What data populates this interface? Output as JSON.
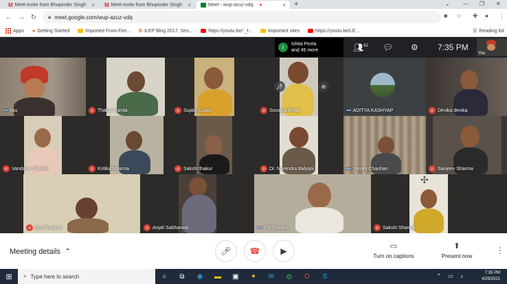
{
  "browser": {
    "tabs": [
      {
        "title": "Meet invite from Bhupinder Singh",
        "icon": "gmail-icon"
      },
      {
        "title": "Meet invite from Bhupinder Singh",
        "icon": "gmail-icon"
      },
      {
        "title": "Meet - wup-azuz-vdq",
        "icon": "meet-icon",
        "active": true
      }
    ],
    "url": "meet.google.com/wup-azuz-vdq",
    "bookmarks": [
      {
        "label": "Apps",
        "icon": "apps-icon"
      },
      {
        "label": "Getting Started",
        "icon": "firefox-icon"
      },
      {
        "label": "Imported From Fire...",
        "icon": "folder-icon"
      },
      {
        "label": "ILEP Blog 2017: Ses...",
        "icon": "blog-icon"
      },
      {
        "label": "https://youtu.be/-_f...",
        "icon": "youtube-icon"
      },
      {
        "label": "Important sites",
        "icon": "folder-icon"
      },
      {
        "label": "https://youtu.be/LE...",
        "icon": "youtube-icon"
      }
    ],
    "reading_list": "Reading list"
  },
  "meet": {
    "presenter": {
      "name": "Ishita Pezta",
      "more": "and 45 more",
      "initial": "I"
    },
    "participants_count": "62",
    "time": "7:35 PM",
    "self_label": "You",
    "tiles": [
      {
        "name": "You",
        "muted": false
      },
      {
        "name": "Thakur Kamla",
        "muted": true
      },
      {
        "name": "Sujata Gupta",
        "muted": true
      },
      {
        "name": "Sunaina Bhatt",
        "muted": true
      },
      {
        "name": "ADITYA KASHYAP",
        "muted": false
      },
      {
        "name": "Devika devika",
        "muted": true
      },
      {
        "name": "Vandana THaNel",
        "muted": true
      },
      {
        "name": "Kritika Sharma",
        "muted": true
      },
      {
        "name": "Sakshi thakur",
        "muted": true
      },
      {
        "name": "Dr. Narendra Balyani",
        "muted": true
      },
      {
        "name": "Yamini Chauhan",
        "muted": false
      },
      {
        "name": "Sanjeev Sharma",
        "muted": true
      },
      {
        "name": "Om Prakash",
        "muted": true
      },
      {
        "name": "Anjali Sabharwal",
        "muted": true
      },
      {
        "name": "L R Sharma",
        "muted": false
      },
      {
        "name": "Sakshi Sharma",
        "muted": true
      }
    ],
    "meeting_details": "Meeting details",
    "captions_label": "Turn on captions",
    "present_label": "Present now"
  },
  "taskbar": {
    "search_placeholder": "Type here to search",
    "time": "7:35 PM",
    "date": "4/29/2021",
    "notification_count": "6"
  }
}
